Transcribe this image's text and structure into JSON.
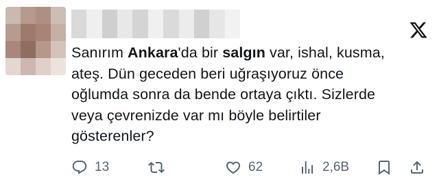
{
  "tweet": {
    "text_segments": [
      {
        "text": "Sanırım ",
        "bold": false
      },
      {
        "text": "Ankara",
        "bold": true
      },
      {
        "text": "'da bir ",
        "bold": false
      },
      {
        "text": "salgın",
        "bold": true
      },
      {
        "text": " var, ishal, kusma,\nateş. Dün geceden beri uğraşıyoruz önce\noğlumda sonra da bende ortaya çıktı. Sizlerde\nveya çevrenizde var mı böyle belirtiler\ngösterenler?",
        "bold": false
      }
    ]
  },
  "actions": {
    "replies": "13",
    "likes": "62",
    "views": "2,6B"
  },
  "icons": {
    "reply": "reply-icon",
    "retweet": "retweet-icon",
    "like": "heart-icon",
    "views": "views-icon",
    "bookmark": "bookmark-icon",
    "share": "share-icon",
    "brand": "x-logo-icon"
  },
  "colors": {
    "icon": "#536471",
    "text": "#0f1419"
  }
}
